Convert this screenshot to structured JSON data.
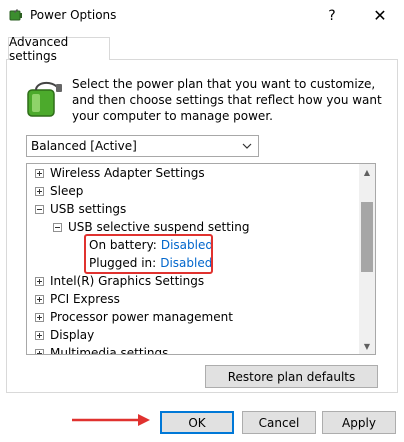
{
  "window": {
    "title": "Power Options",
    "help_label": "?",
    "close_label": "✕"
  },
  "tab": {
    "label": "Advanced settings"
  },
  "description": "Select the power plan that you want to customize, and then choose settings that reflect how you want your computer to manage power.",
  "plan_select": {
    "value": "Balanced [Active]"
  },
  "tree": {
    "items": [
      {
        "label": "Wireless Adapter Settings"
      },
      {
        "label": "Sleep"
      },
      {
        "label": "USB settings"
      },
      {
        "label": "USB selective suspend setting"
      },
      {
        "label": "On battery:",
        "value": "Disabled"
      },
      {
        "label": "Plugged in:",
        "value": "Disabled"
      },
      {
        "label": "Intel(R) Graphics Settings"
      },
      {
        "label": "PCI Express"
      },
      {
        "label": "Processor power management"
      },
      {
        "label": "Display"
      },
      {
        "label": "Multimedia settings"
      }
    ]
  },
  "buttons": {
    "restore": "Restore plan defaults",
    "ok": "OK",
    "cancel": "Cancel",
    "apply": "Apply"
  },
  "colors": {
    "link": "#0066cc",
    "highlight": "#e0322f",
    "focus": "#0078d7"
  }
}
